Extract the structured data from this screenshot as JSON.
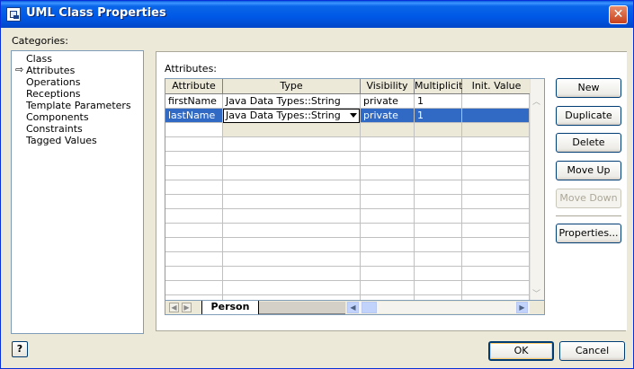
{
  "window": {
    "title": "UML Class Properties",
    "app_icon": "uml-app-icon",
    "close_icon": "close-icon"
  },
  "categories": {
    "label": "Categories:",
    "selected": "Attributes",
    "items": [
      "Class",
      "Attributes",
      "Operations",
      "Receptions",
      "Template Parameters",
      "Components",
      "Constraints",
      "Tagged Values"
    ]
  },
  "attributes": {
    "label": "Attributes:",
    "columns": [
      "Attribute",
      "Type",
      "Visibility",
      "Multiplicity",
      "Init. Value"
    ],
    "rows": [
      {
        "attribute": "firstName",
        "type": "Java Data Types::String",
        "visibility": "private",
        "multiplicity": "1",
        "init_value": ""
      },
      {
        "attribute": "lastName",
        "type": "Java Data Types::String",
        "visibility": "private",
        "multiplicity": "1",
        "init_value": ""
      }
    ],
    "selected_row": 1,
    "sheet_tab": "Person"
  },
  "buttons": {
    "new": "New",
    "duplicate": "Duplicate",
    "delete": "Delete",
    "move_up": "Move Up",
    "move_down": "Move Down",
    "properties": "Properties..."
  },
  "footer": {
    "help": "?",
    "ok": "OK",
    "cancel": "Cancel"
  },
  "colors": {
    "title_bar": "#0058e6",
    "selection": "#316ac5",
    "dialog_bg": "#ece9d8"
  }
}
